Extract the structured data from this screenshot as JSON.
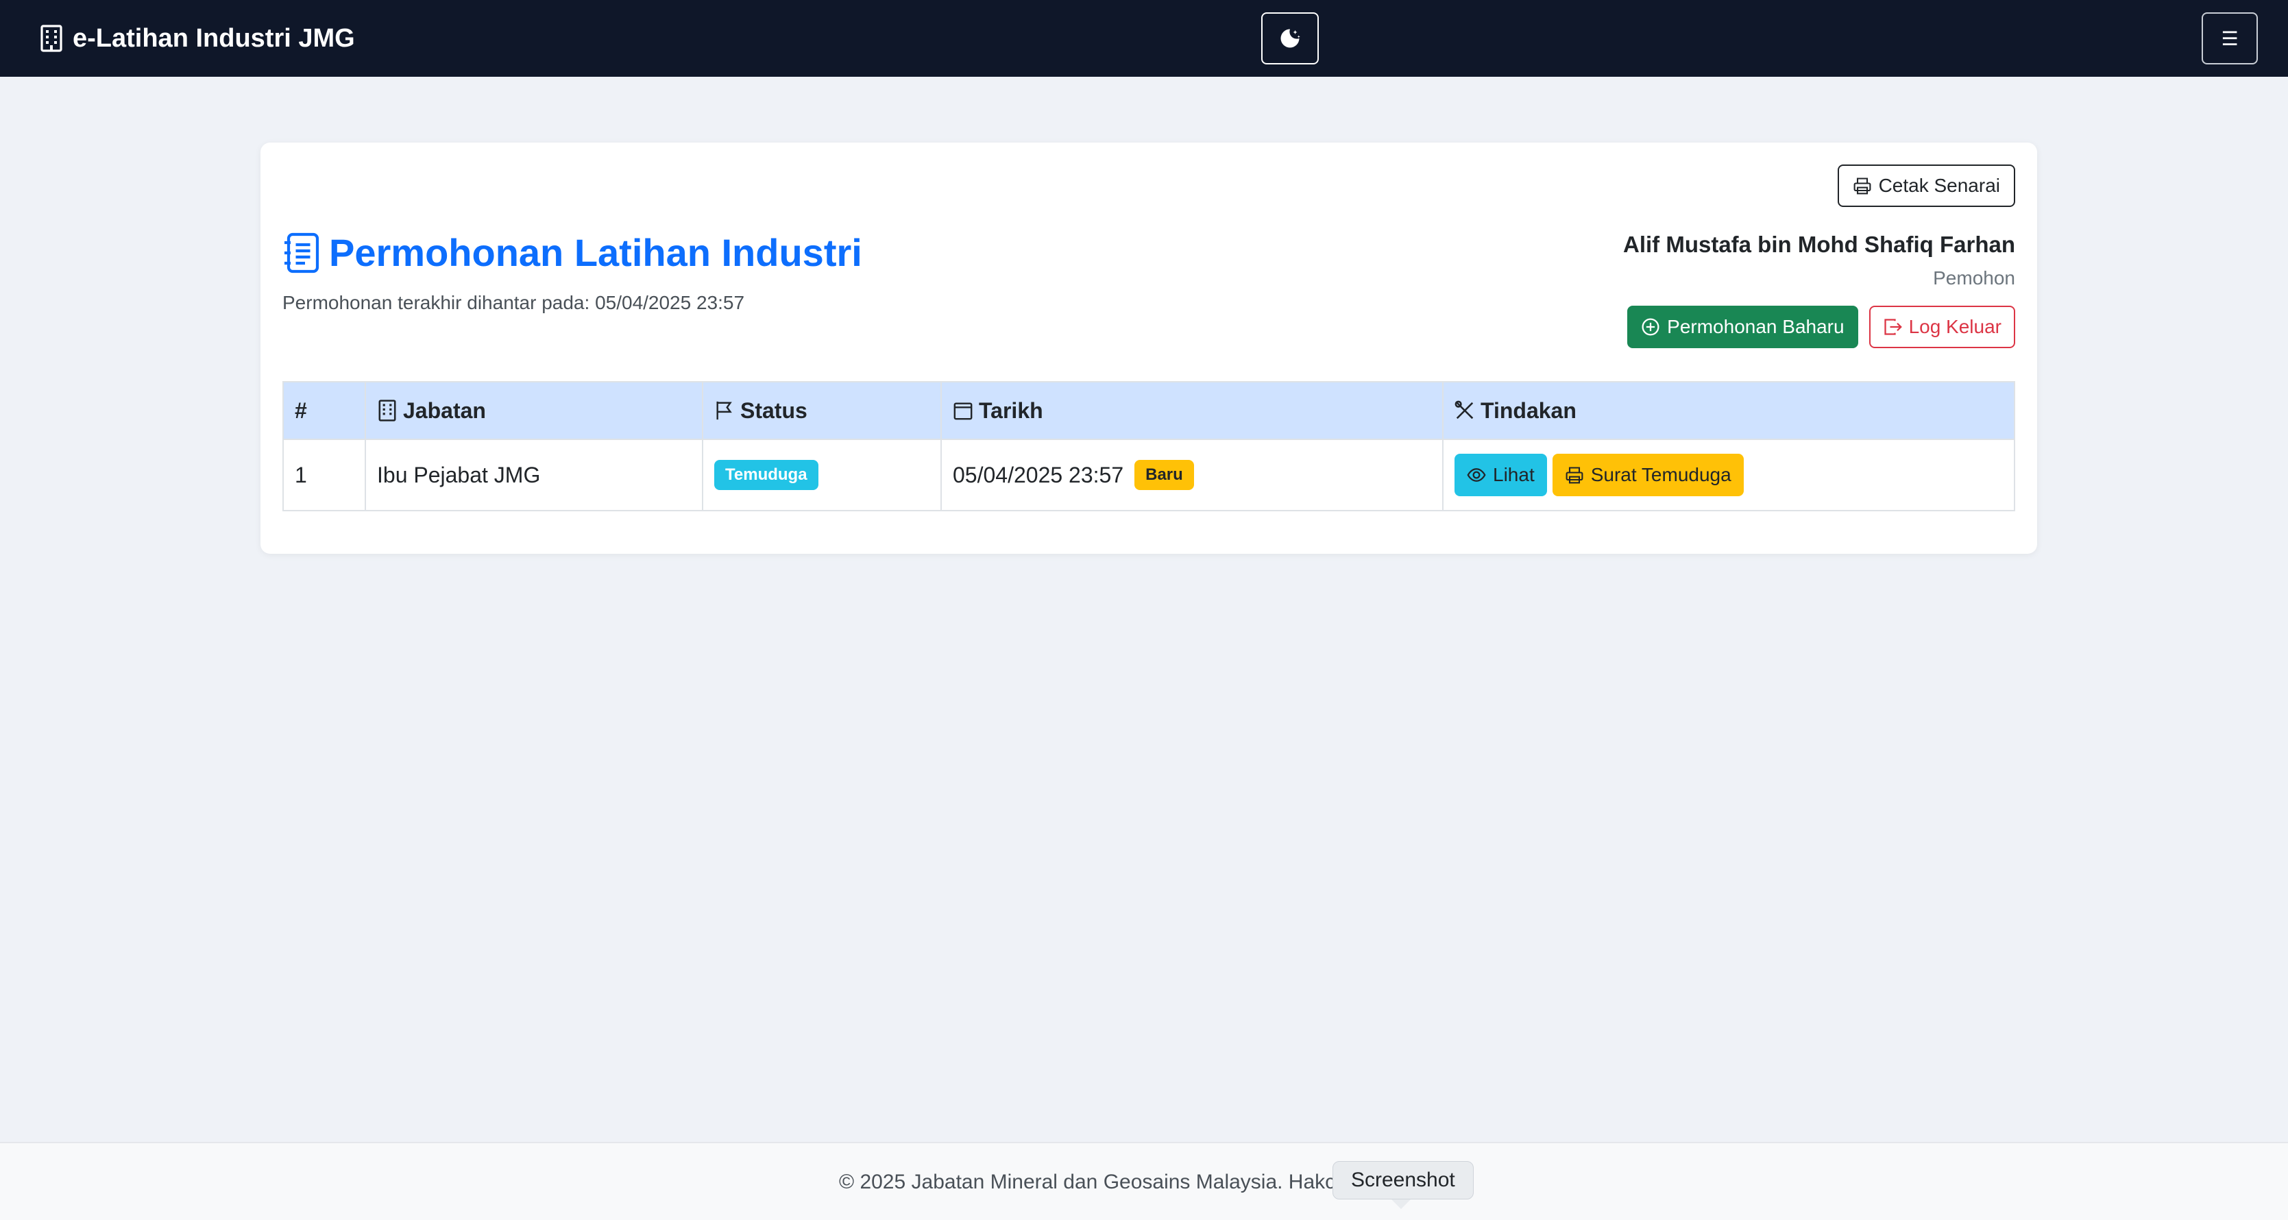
{
  "navbar": {
    "brand": "e-Latihan Industri JMG",
    "brand_icon": "building-icon",
    "theme_toggle_icon": "moon-stars-icon",
    "menu_icon": "hamburger-icon",
    "menu_glyph": "☰"
  },
  "card": {
    "print_list_label": "Cetak Senarai",
    "title": "Permohonan Latihan Industri",
    "subtitle": "Permohonan terakhir dihantar pada: 05/04/2025 23:57",
    "user_name": "Alif Mustafa bin Mohd Shafiq Farhan",
    "user_role": "Pemohon",
    "new_application_label": "Permohonan Baharu",
    "logout_label": "Log Keluar"
  },
  "table": {
    "headers": {
      "num": "#",
      "jabatan": "Jabatan",
      "status": "Status",
      "tarikh": "Tarikh",
      "tindakan": "Tindakan"
    },
    "rows": [
      {
        "num": "1",
        "jabatan": "Ibu Pejabat JMG",
        "status": "Temuduga",
        "tarikh": "05/04/2025 23:57",
        "tarikh_badge": "Baru",
        "view_label": "Lihat",
        "letter_label": "Surat Temuduga"
      }
    ]
  },
  "footer": {
    "text": "© 2025 Jabatan Mineral dan Geosains Malaysia. Hakcip"
  },
  "tooltip": {
    "text": "Screenshot"
  },
  "colors": {
    "navbar_bg": "#0f1729",
    "primary": "#0d6efd",
    "success": "#198754",
    "danger": "#dc3545",
    "info": "#22c3e6",
    "warning": "#ffc107",
    "table_header_bg": "#cfe2ff"
  }
}
